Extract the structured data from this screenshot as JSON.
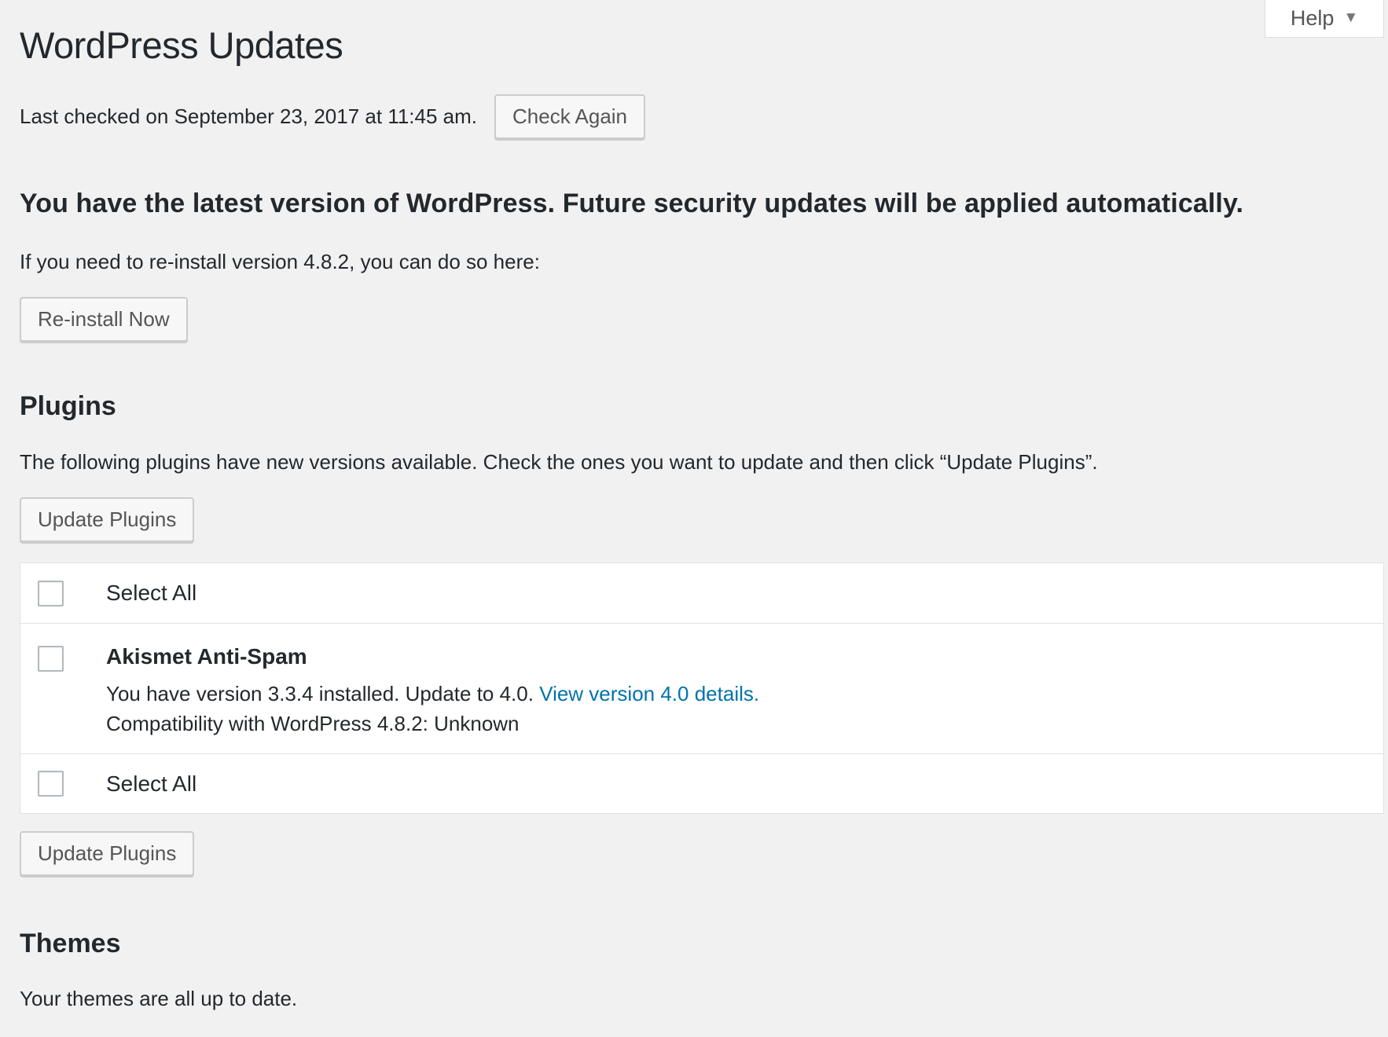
{
  "help_tab": {
    "label": "Help",
    "caret": "▼"
  },
  "page": {
    "title": "WordPress Updates"
  },
  "last_checked": {
    "text": "Last checked on September 23, 2017 at 11:45 am.",
    "button_label": "Check Again"
  },
  "core": {
    "heading": "You have the latest version of WordPress. Future security updates will be applied automatically.",
    "reinstall_text": "If you need to re-install version 4.8.2, you can do so here:",
    "reinstall_button": "Re-install Now"
  },
  "plugins": {
    "heading": "Plugins",
    "description": "The following plugins have new versions available. Check the ones you want to update and then click “Update Plugins”.",
    "update_button": "Update Plugins",
    "select_all_label": "Select All",
    "items": [
      {
        "name": "Akismet Anti-Spam",
        "version_text": "You have version 3.3.4 installed. Update to 4.0.",
        "details_link": "View version 4.0 details.",
        "compatibility": "Compatibility with WordPress 4.8.2: Unknown",
        "checked": false
      }
    ]
  },
  "themes": {
    "heading": "Themes",
    "description": "Your themes are all up to date."
  },
  "colors": {
    "background": "#f1f1f1",
    "text": "#23282d",
    "link": "#0073aa",
    "button_text": "#555555",
    "button_border": "#cccccc"
  }
}
